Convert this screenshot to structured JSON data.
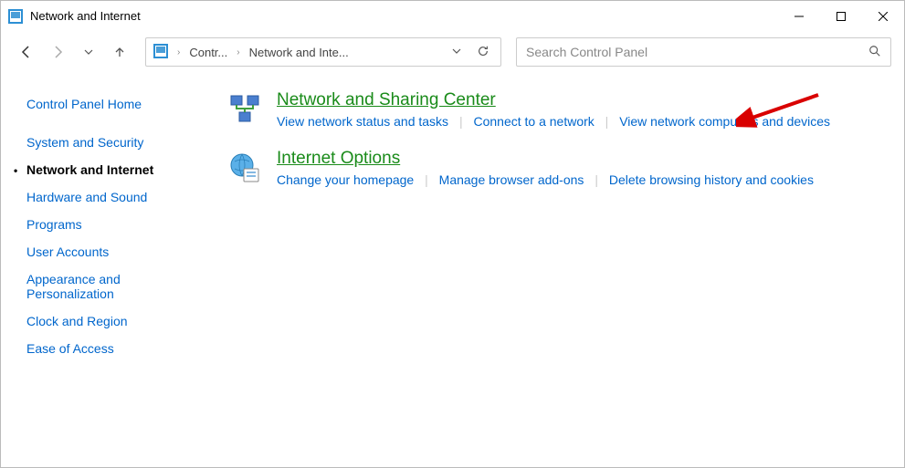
{
  "window": {
    "title": "Network and Internet"
  },
  "breadcrumb": {
    "root": "Contr...",
    "current": "Network and Inte..."
  },
  "search": {
    "placeholder": "Search Control Panel"
  },
  "sidebar": {
    "home": "Control Panel Home",
    "items": [
      "System and Security",
      "Network and Internet",
      "Hardware and Sound",
      "Programs",
      "User Accounts",
      "Appearance and Personalization",
      "Clock and Region",
      "Ease of Access"
    ],
    "active_index": 1
  },
  "categories": [
    {
      "heading": "Network and Sharing Center",
      "links": [
        "View network status and tasks",
        "Connect to a network",
        "View network computers and devices"
      ]
    },
    {
      "heading": "Internet Options",
      "links": [
        "Change your homepage",
        "Manage browser add-ons",
        "Delete browsing history and cookies"
      ]
    }
  ]
}
